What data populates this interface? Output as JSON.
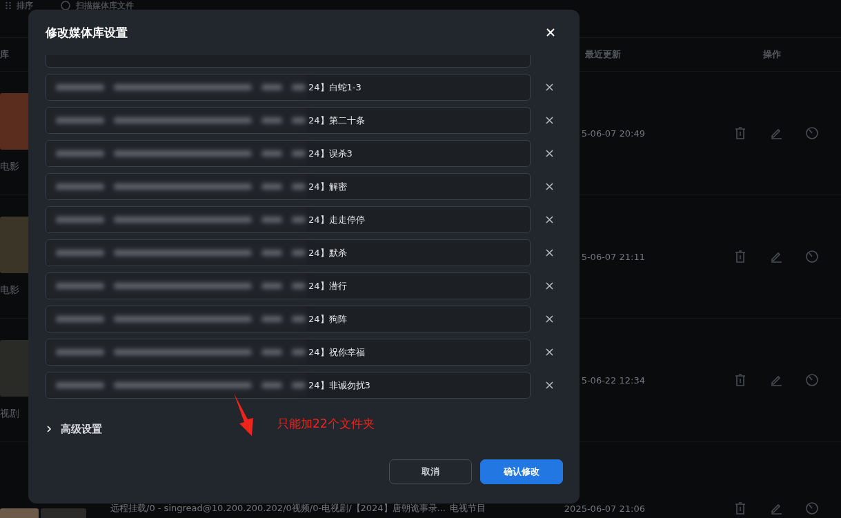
{
  "top_bar": {
    "items": [
      {
        "label": "排序",
        "kind": "sort"
      },
      {
        "label": "扫描媒体库文件",
        "kind": "scan"
      }
    ]
  },
  "table": {
    "columns": [
      "库",
      "最近更新",
      "操作"
    ],
    "rows": [
      {
        "caption": "电影",
        "updated": "5-06-07 20:49"
      },
      {
        "caption": "电影",
        "updated": "5-06-07 21:11"
      },
      {
        "caption": "视剧",
        "updated": "5-06-22 12:34"
      },
      {
        "path": "远程挂载/0 - singread@10.200.200.202/0视频/0-电视剧/【2024】唐朝诡事录...",
        "type": "电视节目",
        "updated": "2025-06-07 21:06"
      }
    ]
  },
  "dialog": {
    "title": "修改媒体库设置",
    "folders": [
      "24】白蛇1-3",
      "24】第二十条",
      "24】误杀3",
      "24】解密",
      "24】走走停停",
      "24】默杀",
      "24】潜行",
      "24】狗阵",
      "24】祝你幸福",
      "24】非诚勿扰3"
    ],
    "advanced": {
      "label": "高级设置",
      "expanded": false
    },
    "buttons": [
      {
        "label": "取消",
        "kind": "secondary"
      },
      {
        "label": "确认修改",
        "kind": "primary"
      }
    ]
  },
  "annotation": {
    "text": "只能加22个文件夹"
  }
}
